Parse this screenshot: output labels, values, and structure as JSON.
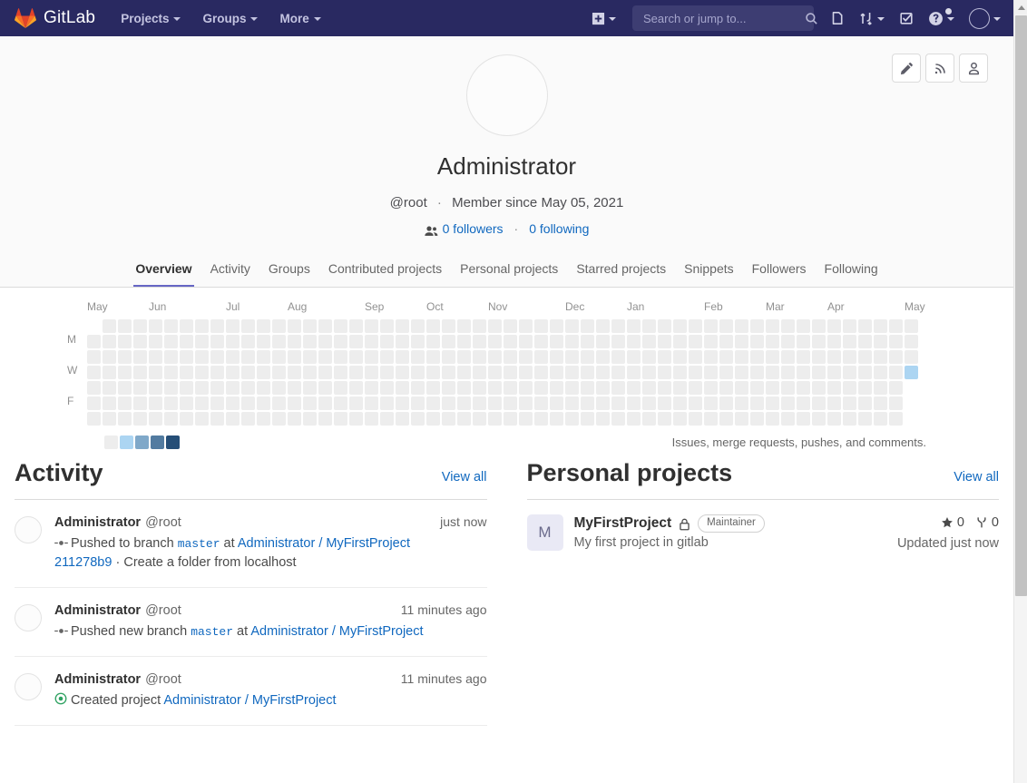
{
  "navbar": {
    "brand": "GitLab",
    "brand_icon": "gitlab-logo-icon",
    "items": [
      {
        "label": "Projects",
        "icon": "chevron-down-icon"
      },
      {
        "label": "Groups",
        "icon": "chevron-down-icon"
      },
      {
        "label": "More",
        "icon": "chevron-down-icon"
      }
    ],
    "create_new_icon": "plus-square-icon",
    "search": {
      "placeholder": "Search or jump to...",
      "value": "",
      "icon": "search-icon"
    },
    "issues_icon": "issues-icon",
    "merge_requests_icon": "merge-request-icon",
    "todos_icon": "todo-checkbox-icon",
    "help_icon": "question-circle-icon",
    "user_avatar_icon": "user-avatar-icon",
    "brand_color": "#292961",
    "accent_color": "#6666c4"
  },
  "profile": {
    "avatar_alt": "user-avatar",
    "name": "Administrator",
    "username": "@root",
    "separator": "·",
    "member_since": "Member since May 05, 2021",
    "followers_label": "0 followers",
    "following_label": "0 following",
    "followers_icon": "users-icon",
    "actions": [
      {
        "name": "edit-profile-button",
        "icon": "pencil-icon"
      },
      {
        "name": "rss-feed-button",
        "icon": "rss-icon"
      },
      {
        "name": "report-abuse-button",
        "icon": "user-report-icon"
      }
    ]
  },
  "tabs": [
    {
      "label": "Overview",
      "active": true
    },
    {
      "label": "Activity",
      "active": false
    },
    {
      "label": "Groups",
      "active": false
    },
    {
      "label": "Contributed projects",
      "active": false
    },
    {
      "label": "Personal projects",
      "active": false
    },
    {
      "label": "Starred projects",
      "active": false
    },
    {
      "label": "Snippets",
      "active": false
    },
    {
      "label": "Followers",
      "active": false
    },
    {
      "label": "Following",
      "active": false
    }
  ],
  "chart_data": {
    "type": "heatmap",
    "title": "Contribution calendar",
    "caption": "Issues, merge requests, pushes, and comments.",
    "months": [
      "May",
      "Jun",
      "Jul",
      "Aug",
      "Sep",
      "Oct",
      "Nov",
      "Dec",
      "Jan",
      "Feb",
      "Mar",
      "Apr",
      "May"
    ],
    "month_column_index": [
      0,
      4,
      9,
      13,
      18,
      22,
      26,
      31,
      35,
      40,
      44,
      48,
      53
    ],
    "day_labels": [
      "",
      "M",
      "",
      "W",
      "",
      "F",
      ""
    ],
    "weeks": 54,
    "days_per_week": 7,
    "first_week_start_row": 1,
    "last_week_end_row": 3,
    "empty_color": "#ededed",
    "legend_colors": [
      "#ededed",
      "#acd5f2",
      "#7fa8c9",
      "#527ba0",
      "#254e77"
    ],
    "legend_levels": [
      0,
      1,
      2,
      3,
      4
    ],
    "active_cells": [
      {
        "week": 53,
        "day": 3,
        "level": 1,
        "color": "#acd5f2"
      }
    ]
  },
  "activity": {
    "title": "Activity",
    "view_all": "View all",
    "events": [
      {
        "author": "Administrator",
        "handle": "@root",
        "time": "just now",
        "icon": "commit-icon",
        "action": "Pushed to branch",
        "branch": "master",
        "at": "at",
        "project": "Administrator / MyFirstProject",
        "commit_sha": "211278b9",
        "commit_sep": "·",
        "commit_message": "Create a folder from localhost"
      },
      {
        "author": "Administrator",
        "handle": "@root",
        "time": "11 minutes ago",
        "icon": "commit-icon",
        "action": "Pushed new branch",
        "branch": "master",
        "at": "at",
        "project": "Administrator / MyFirstProject",
        "commit_sha": "",
        "commit_sep": "",
        "commit_message": ""
      },
      {
        "author": "Administrator",
        "handle": "@root",
        "time": "11 minutes ago",
        "icon": "status-created-icon",
        "action": "Created project",
        "branch": "",
        "at": "",
        "project": "Administrator / MyFirstProject",
        "commit_sha": "",
        "commit_sep": "",
        "commit_message": ""
      }
    ]
  },
  "projects": {
    "title": "Personal projects",
    "view_all": "View all",
    "items": [
      {
        "initial": "M",
        "name": "MyFirstProject",
        "visibility_icon": "lock-icon",
        "role_badge": "Maintainer",
        "description": "My first project in gitlab",
        "stars_icon": "star-icon",
        "stars": "0",
        "forks_icon": "fork-icon",
        "forks": "0",
        "updated": "Updated just now"
      }
    ]
  }
}
